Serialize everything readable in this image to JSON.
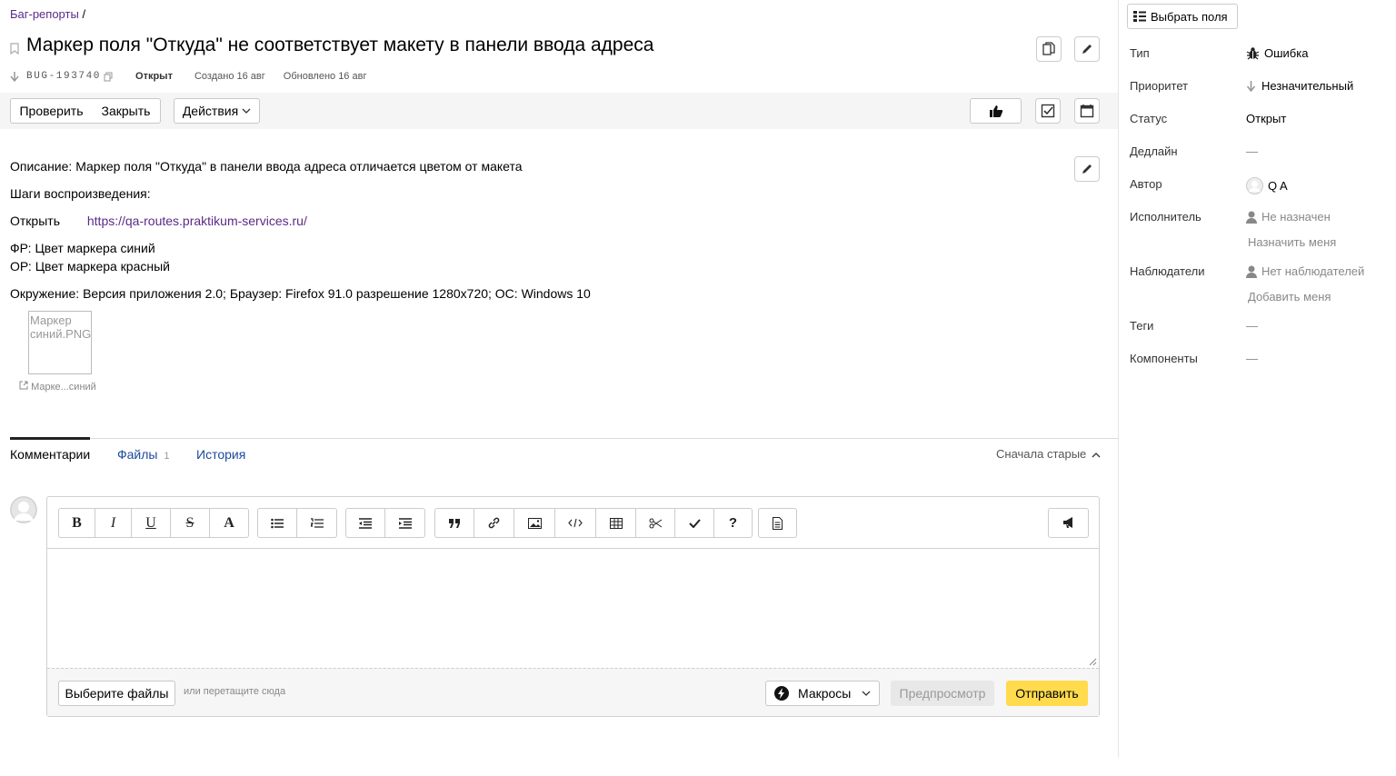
{
  "breadcrumb": {
    "link": "Баг-репорты",
    "sep": "/"
  },
  "issue": {
    "title": "Маркер поля \"Откуда\" не соответствует макету в панели ввода адреса",
    "key": "BUG-193740",
    "status": "Открыт",
    "created": "Создано 16 авг",
    "updated": "Обновлено 16 авг"
  },
  "toolbar": {
    "check": "Проверить",
    "close": "Закрыть",
    "actions": "Действия"
  },
  "description": {
    "line1": "Описание: Маркер поля \"Откуда\" в панели ввода адреса отличается цветом от макета",
    "line2": "Шаги воспроизведения:",
    "open_label": "Открыть",
    "open_link": "https://qa-routes.praktikum-services.ru/",
    "fr": "ФР: Цвет маркера синий",
    "or": "ОР: Цвет маркера красный",
    "env": "Окружение: Версия приложения 2.0; Браузер: Firefox 91.0 разрешение 1280x720; ОС: Windows 10",
    "attachment_alt": "Маркер синий.PNG",
    "attachment_caption": "Марке...синий"
  },
  "tabs": {
    "comments": "Комментарии",
    "files": "Файлы",
    "files_count": "1",
    "history": "История",
    "sort": "Сначала старые"
  },
  "editor": {
    "toolbar": {
      "bold": "B",
      "italic": "I",
      "underline": "U",
      "strike": "S",
      "color": "A",
      "help": "?"
    },
    "choose_files": "Выберите файлы",
    "drop_hint": "или перетащите сюда",
    "macros": "Макросы",
    "preview": "Предпросмотр",
    "send": "Отправить"
  },
  "sidebar": {
    "choose_fields": "Выбрать поля",
    "type_label": "Тип",
    "type_value": "Ошибка",
    "priority_label": "Приоритет",
    "priority_value": "Незначительный",
    "status_label": "Статус",
    "status_value": "Открыт",
    "deadline_label": "Дедлайн",
    "deadline_value": "—",
    "author_label": "Автор",
    "author_value": "Q A",
    "assignee_label": "Исполнитель",
    "assignee_value": "Не назначен",
    "assign_me": "Назначить меня",
    "watchers_label": "Наблюдатели",
    "watchers_value": "Нет наблюдателей",
    "add_me": "Добавить меня",
    "tags_label": "Теги",
    "tags_value": "—",
    "components_label": "Компоненты",
    "components_value": "—"
  },
  "colors": {
    "accent": "#5b2a86",
    "link_blue": "#1a4a9c",
    "send_yellow": "#ffdb4d"
  }
}
